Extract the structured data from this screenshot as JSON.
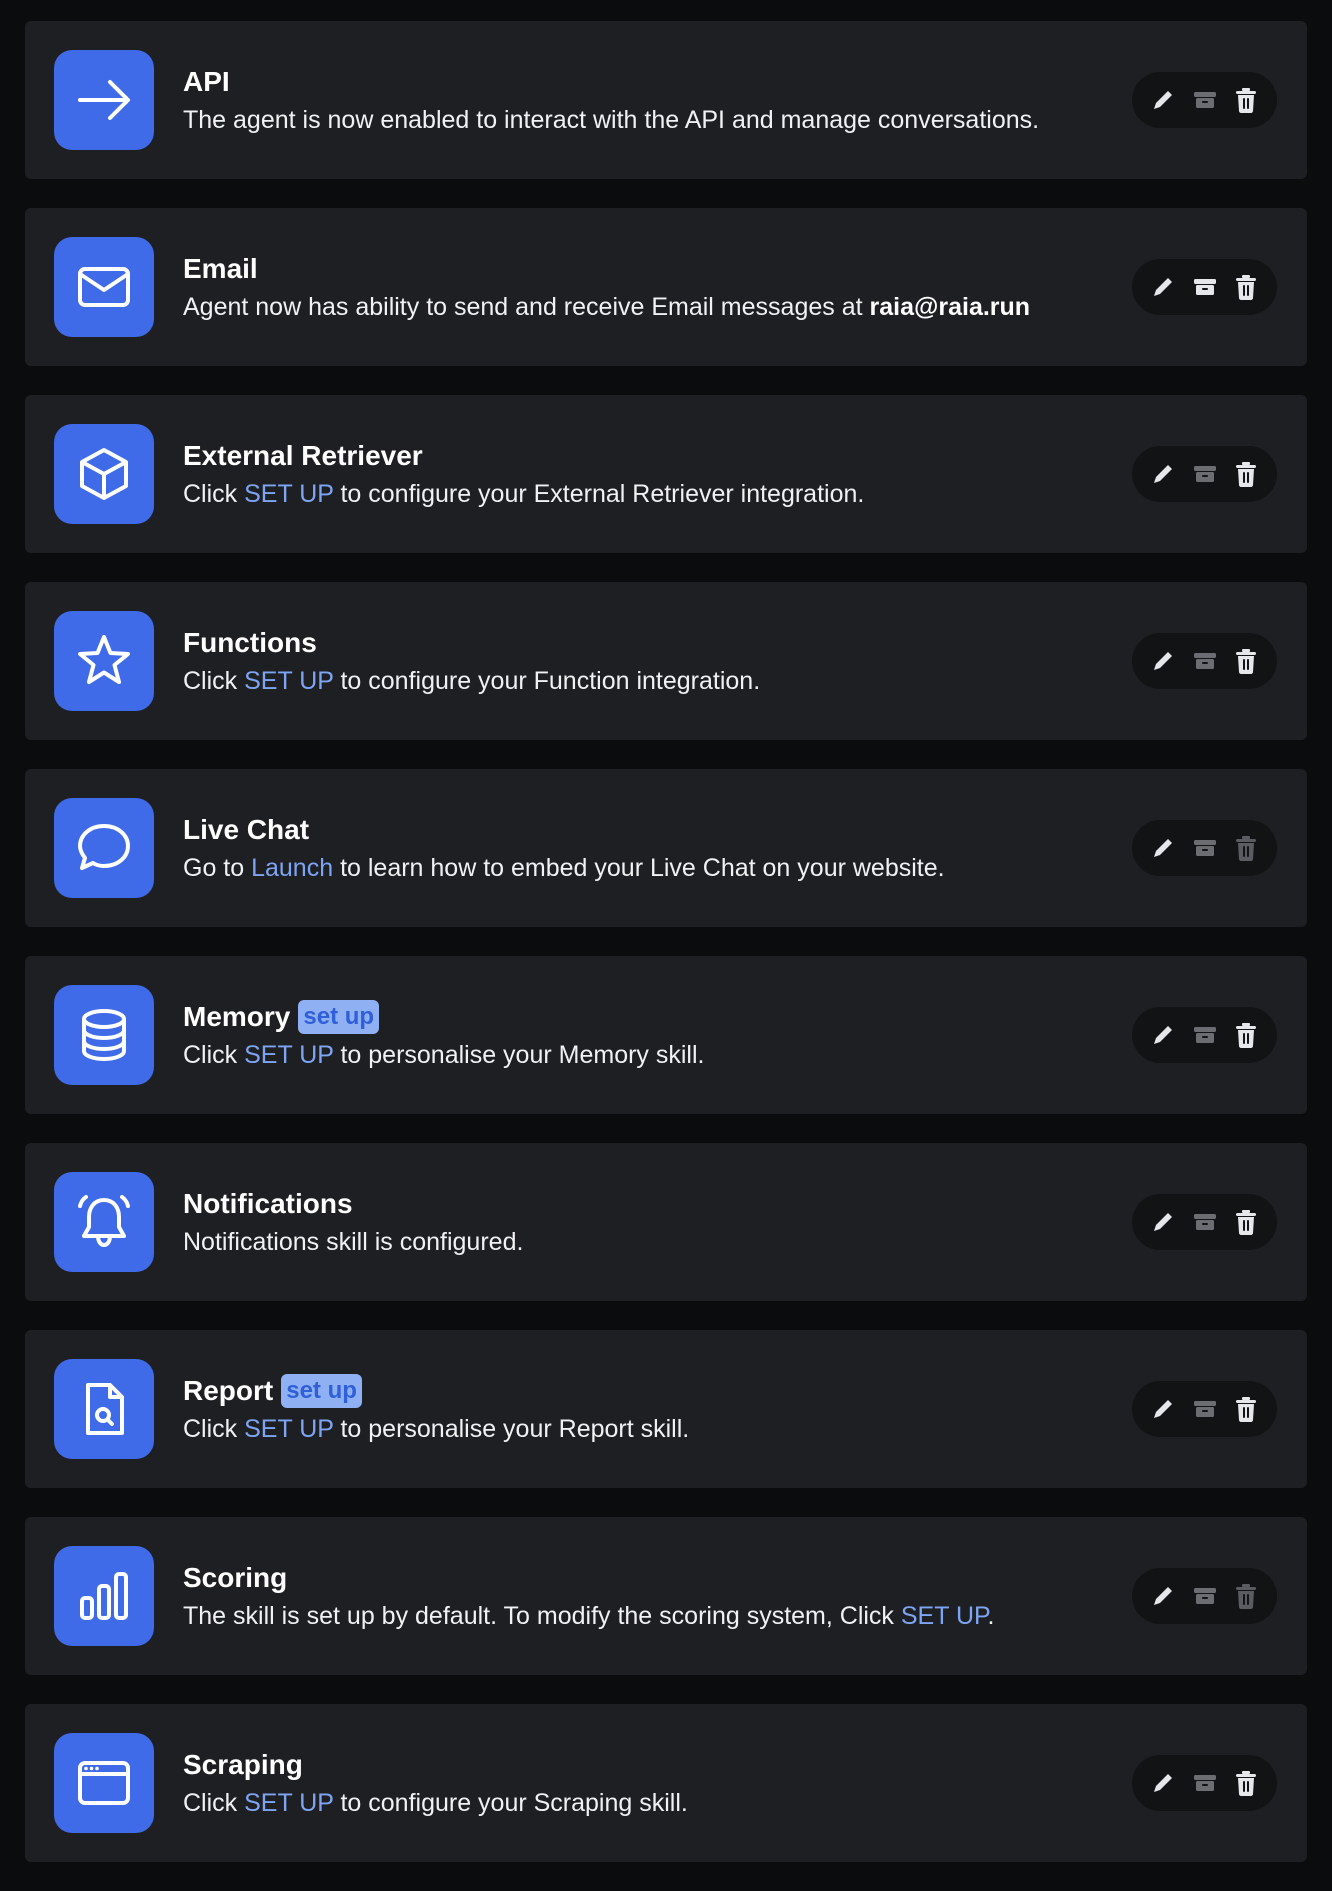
{
  "colors": {
    "accent": "#3f6be8",
    "link": "#7ea4f4",
    "card": "#1e1f22",
    "background": "#0b0c0d"
  },
  "skills": [
    {
      "icon": "arrow-right-icon",
      "title": "API",
      "badge": "",
      "desc": {
        "before": "The agent is now enabled to interact with the API and manage conversations.",
        "link": "",
        "after": "",
        "strong": ""
      },
      "actions": {
        "archive_enabled": false,
        "delete_enabled": true
      }
    },
    {
      "icon": "mail-icon",
      "title": "Email",
      "badge": "",
      "desc": {
        "before": "Agent now has ability to send and receive Email messages at ",
        "link": "",
        "after": "",
        "strong": "raia@raia.run"
      },
      "actions": {
        "archive_enabled": true,
        "delete_enabled": true
      }
    },
    {
      "icon": "cube-icon",
      "title": "External Retriever",
      "badge": "",
      "desc": {
        "before": "Click ",
        "link": "SET UP",
        "after": " to configure your External Retriever integration.",
        "strong": ""
      },
      "actions": {
        "archive_enabled": false,
        "delete_enabled": true
      }
    },
    {
      "icon": "star-icon",
      "title": "Functions",
      "badge": "",
      "desc": {
        "before": "Click ",
        "link": "SET UP",
        "after": " to configure your Function integration.",
        "strong": ""
      },
      "actions": {
        "archive_enabled": false,
        "delete_enabled": true
      }
    },
    {
      "icon": "chat-bubble-icon",
      "title": "Live Chat",
      "badge": "",
      "desc": {
        "before": "Go to ",
        "link": "Launch",
        "after": " to learn how to embed your Live Chat on your website.",
        "strong": ""
      },
      "actions": {
        "archive_enabled": false,
        "delete_enabled": false
      }
    },
    {
      "icon": "database-icon",
      "title": "Memory",
      "badge": "set up",
      "desc": {
        "before": "Click ",
        "link": "SET UP",
        "after": " to personalise your Memory skill.",
        "strong": ""
      },
      "actions": {
        "archive_enabled": false,
        "delete_enabled": true
      }
    },
    {
      "icon": "bell-icon",
      "title": "Notifications",
      "badge": "",
      "desc": {
        "before": "Notifications skill is configured.",
        "link": "",
        "after": "",
        "strong": ""
      },
      "actions": {
        "archive_enabled": false,
        "delete_enabled": true
      }
    },
    {
      "icon": "document-search-icon",
      "title": "Report",
      "badge": "set up",
      "desc": {
        "before": "Click ",
        "link": "SET UP",
        "after": " to personalise your Report skill.",
        "strong": ""
      },
      "actions": {
        "archive_enabled": false,
        "delete_enabled": true
      }
    },
    {
      "icon": "bar-chart-icon",
      "title": "Scoring",
      "badge": "",
      "desc": {
        "before": "The skill is set up by default. To modify the scoring system, Click ",
        "link": "SET UP",
        "after": ".",
        "strong": ""
      },
      "actions": {
        "archive_enabled": false,
        "delete_enabled": false
      }
    },
    {
      "icon": "browser-window-icon",
      "title": "Scraping",
      "badge": "",
      "desc": {
        "before": "Click ",
        "link": "SET UP",
        "after": " to configure your Scraping skill.",
        "strong": ""
      },
      "actions": {
        "archive_enabled": false,
        "delete_enabled": true
      }
    }
  ]
}
